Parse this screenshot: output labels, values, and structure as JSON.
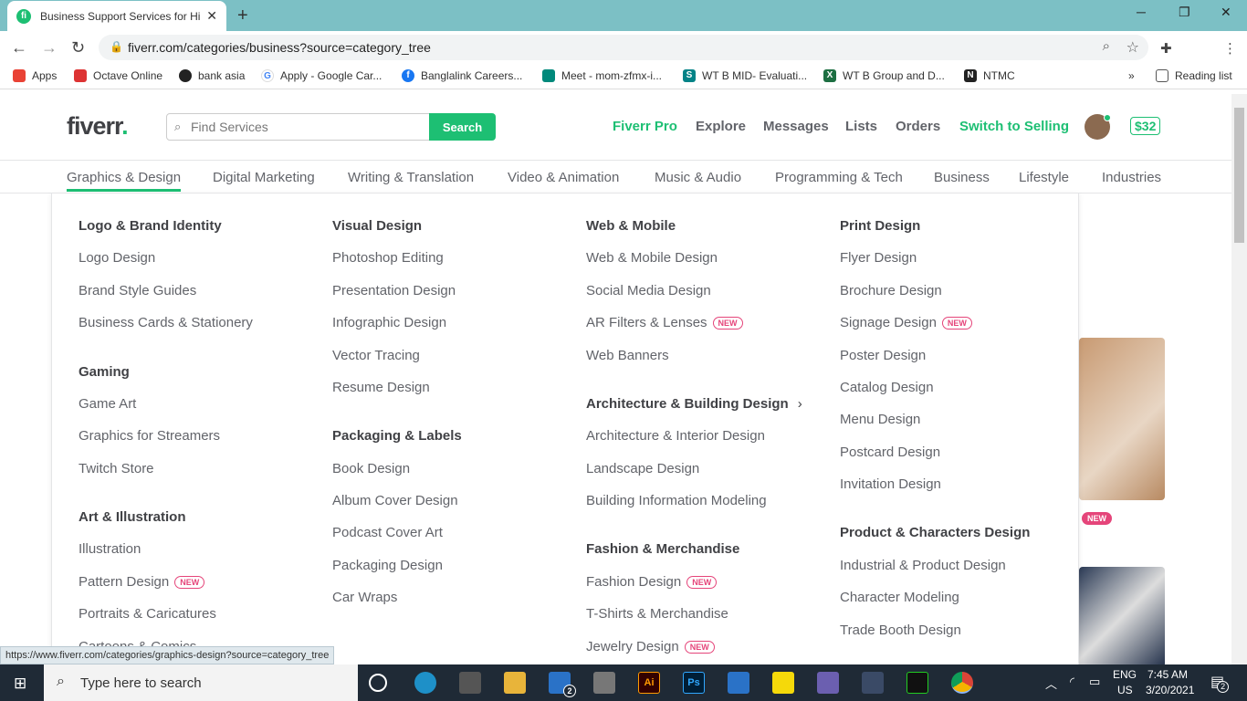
{
  "browser": {
    "tab_title": "Business Support Services for Hir",
    "url": "fiverr.com/categories/business?source=category_tree",
    "bookmarks": [
      "Apps",
      "Octave Online",
      "bank asia",
      "Apply - Google Car...",
      "Banglalink Careers...",
      "Meet - mom-zfmx-i...",
      "WT B MID- Evaluati...",
      "WT B Group and D...",
      "NTMC"
    ],
    "reading_list": "Reading list",
    "more_bookmarks": "»"
  },
  "header": {
    "logo": "fiverr",
    "logo_dot": ".",
    "search_placeholder": "Find Services",
    "search_button": "Search",
    "nav": {
      "fiverr_pro": "Fiverr Pro",
      "explore": "Explore",
      "messages": "Messages",
      "lists": "Lists",
      "orders": "Orders",
      "switch": "Switch to Selling",
      "balance": "$32"
    }
  },
  "categories": [
    "Graphics & Design",
    "Digital Marketing",
    "Writing & Translation",
    "Video & Animation",
    "Music & Audio",
    "Programming & Tech",
    "Business",
    "Lifestyle",
    "Industries"
  ],
  "mega": {
    "col1": {
      "h1": "Logo & Brand Identity",
      "i1": "Logo Design",
      "i2": "Brand Style Guides",
      "i3": "Business Cards & Stationery",
      "h2": "Gaming",
      "i4": "Game Art",
      "i5": "Graphics for Streamers",
      "i6": "Twitch Store",
      "h3": "Art & Illustration",
      "i7": "Illustration",
      "i8": "Pattern Design",
      "i9": "Portraits & Caricatures",
      "i10": "Cartoons & Comics"
    },
    "col2": {
      "h1": "Visual Design",
      "i1": "Photoshop Editing",
      "i2": "Presentation Design",
      "i3": "Infographic Design",
      "i4": "Vector Tracing",
      "i5": "Resume Design",
      "h2": "Packaging & Labels",
      "i6": "Book Design",
      "i7": "Album Cover Design",
      "i8": "Podcast Cover Art",
      "i9": "Packaging Design",
      "i10": "Car Wraps"
    },
    "col3": {
      "h1": "Web & Mobile",
      "i1": "Web & Mobile Design",
      "i2": "Social Media Design",
      "i3": "AR Filters & Lenses",
      "i4": "Web Banners",
      "h2": "Architecture & Building Design",
      "i5": "Architecture & Interior Design",
      "i6": "Landscape Design",
      "i7": "Building Information Modeling",
      "h3": "Fashion & Merchandise",
      "i8": "Fashion Design",
      "i9": "T-Shirts & Merchandise",
      "i10": "Jewelry Design"
    },
    "col4": {
      "h1": "Print Design",
      "i1": "Flyer Design",
      "i2": "Brochure Design",
      "i3": "Signage Design",
      "i4": "Poster Design",
      "i5": "Catalog Design",
      "i6": "Menu Design",
      "i7": "Postcard Design",
      "i8": "Invitation Design",
      "h2": "Product & Characters Design",
      "i9": "Industrial & Product Design",
      "i10": "Character Modeling",
      "i11": "Trade Booth Design"
    },
    "new_badge": "NEW"
  },
  "status_url": "https://www.fiverr.com/categories/graphics-design?source=category_tree",
  "taskbar": {
    "search_placeholder": "Type here to search",
    "lang1": "ENG",
    "lang2": "US",
    "time": "7:45 AM",
    "date": "3/20/2021",
    "mail_badge": "2",
    "notif_badge": "2"
  }
}
